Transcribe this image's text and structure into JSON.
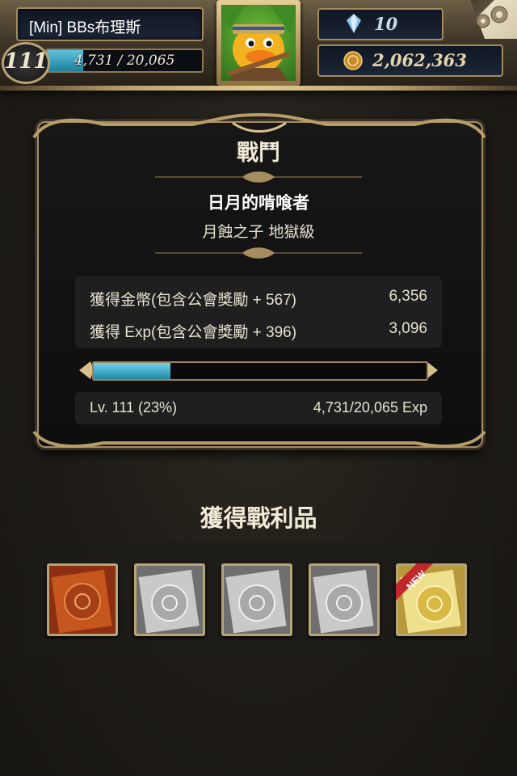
{
  "header": {
    "player_name": "[Min] BBs布理斯",
    "level": "111",
    "xp_text": "4,731 / 20,065",
    "xp_progress": 0.2358,
    "gems": "10",
    "coins": "2,062,363",
    "avatar": "duck-warrior-avatar",
    "icons": {
      "gem": "blue-crystal-icon",
      "coin": "gold-coin-icon",
      "settings": "gear-icon"
    }
  },
  "battle": {
    "title": "戰鬥",
    "quest_name": "日月的啃喰者",
    "quest_subtitle": "月蝕之子 地獄級",
    "rewards": [
      {
        "label": "獲得金幣(包含公會獎勵 + 567)",
        "value": "6,356"
      },
      {
        "label": "獲得 Exp(包含公會獎勵 + 396)",
        "value": "3,096"
      }
    ],
    "exp_progress": 0.23,
    "level_text": "Lv. 111 (23%)",
    "exp_text": "4,731/20,065 Exp"
  },
  "spoils": {
    "title": "獲得戰利品",
    "new_badge": "NEW",
    "items": [
      {
        "type": "bronze-emblem-card"
      },
      {
        "type": "silver-emblem-card"
      },
      {
        "type": "silver-emblem-card"
      },
      {
        "type": "silver-emblem-card"
      },
      {
        "type": "gold-emblem-card",
        "new": true
      }
    ]
  },
  "colors": {
    "accent_gold": "#a58d60",
    "exp_cyan": "#4fb8d4",
    "new_ribbon": "#c0262b"
  }
}
